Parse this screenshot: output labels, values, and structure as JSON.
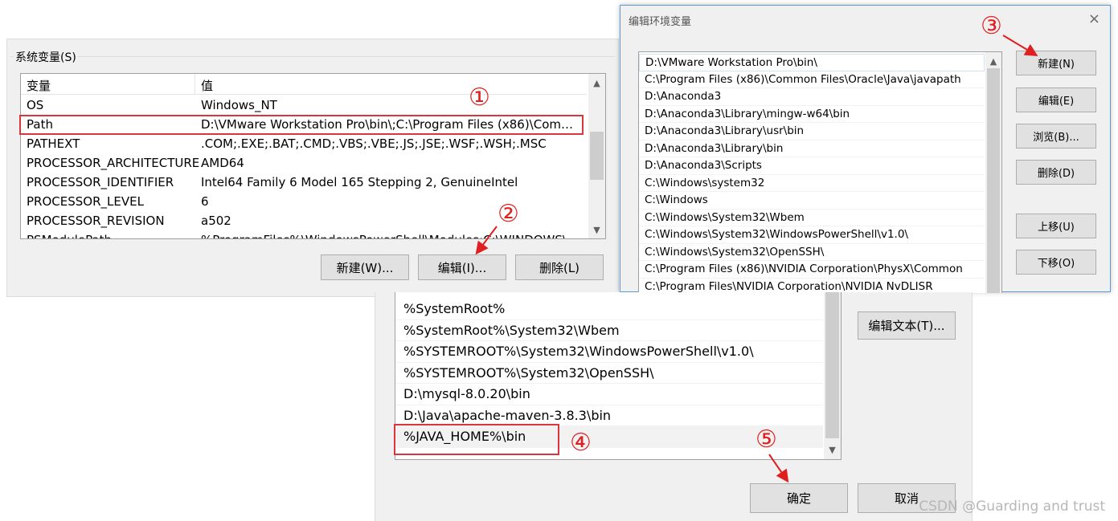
{
  "system_vars": {
    "group_label": "系统变量(S)",
    "columns": [
      "变量",
      "值"
    ],
    "rows": [
      {
        "name": "OS",
        "value": "Windows_NT"
      },
      {
        "name": "Path",
        "value": "D:\\VMware Workstation Pro\\bin\\;C:\\Program Files (x86)\\Comm..."
      },
      {
        "name": "PATHEXT",
        "value": ".COM;.EXE;.BAT;.CMD;.VBS;.VBE;.JS;.JSE;.WSF;.WSH;.MSC"
      },
      {
        "name": "PROCESSOR_ARCHITECTURE",
        "value": "AMD64"
      },
      {
        "name": "PROCESSOR_IDENTIFIER",
        "value": "Intel64 Family 6 Model 165 Stepping 2, GenuineIntel"
      },
      {
        "name": "PROCESSOR_LEVEL",
        "value": "6"
      },
      {
        "name": "PROCESSOR_REVISION",
        "value": "a502"
      },
      {
        "name": "PSModulePath",
        "value": "%ProgramFiles%\\WindowsPowerShell\\Modules;C:\\WINDOWS\\..."
      }
    ],
    "buttons": {
      "new": "新建(W)...",
      "edit": "编辑(I)...",
      "delete": "删除(L)"
    }
  },
  "edit_env_small": {
    "title": "编辑环境变量",
    "close_glyph": "×",
    "items": [
      "D:\\VMware Workstation Pro\\bin\\",
      "C:\\Program Files (x86)\\Common Files\\Oracle\\Java\\javapath",
      "D:\\Anaconda3",
      "D:\\Anaconda3\\Library\\mingw-w64\\bin",
      "D:\\Anaconda3\\Library\\usr\\bin",
      "D:\\Anaconda3\\Library\\bin",
      "D:\\Anaconda3\\Scripts",
      "C:\\Windows\\system32",
      "C:\\Windows",
      "C:\\Windows\\System32\\Wbem",
      "C:\\Windows\\System32\\WindowsPowerShell\\v1.0\\",
      "C:\\Windows\\System32\\OpenSSH\\",
      "C:\\Program Files (x86)\\NVIDIA Corporation\\PhysX\\Common",
      "C:\\Program Files\\NVIDIA Corporation\\NVIDIA NvDLISR"
    ],
    "buttons": {
      "new": "新建(N)",
      "edit": "编辑(E)",
      "browse": "浏览(B)...",
      "delete": "删除(D)",
      "move_up": "上移(U)",
      "move_down": "下移(O)"
    }
  },
  "edit_env_large": {
    "items": [
      "%SystemRoot%",
      "%SystemRoot%\\System32\\Wbem",
      "%SYSTEMROOT%\\System32\\WindowsPowerShell\\v1.0\\",
      "%SYSTEMROOT%\\System32\\OpenSSH\\",
      "D:\\mysql-8.0.20\\bin",
      "D:\\Java\\apache-maven-3.8.3\\bin",
      "%JAVA_HOME%\\bin"
    ],
    "buttons": {
      "edit_text": "编辑文本(T)...",
      "ok": "确定",
      "cancel": "取消"
    }
  },
  "annotations": {
    "n1": "①",
    "n2": "②",
    "n3": "③",
    "n4": "④",
    "n5": "⑤"
  },
  "watermark": "CSDN @Guarding and trust",
  "colors": {
    "annotation_red": "#e02020",
    "dialog_bg": "#f0f0f0",
    "button_bg": "#e1e1e1"
  }
}
